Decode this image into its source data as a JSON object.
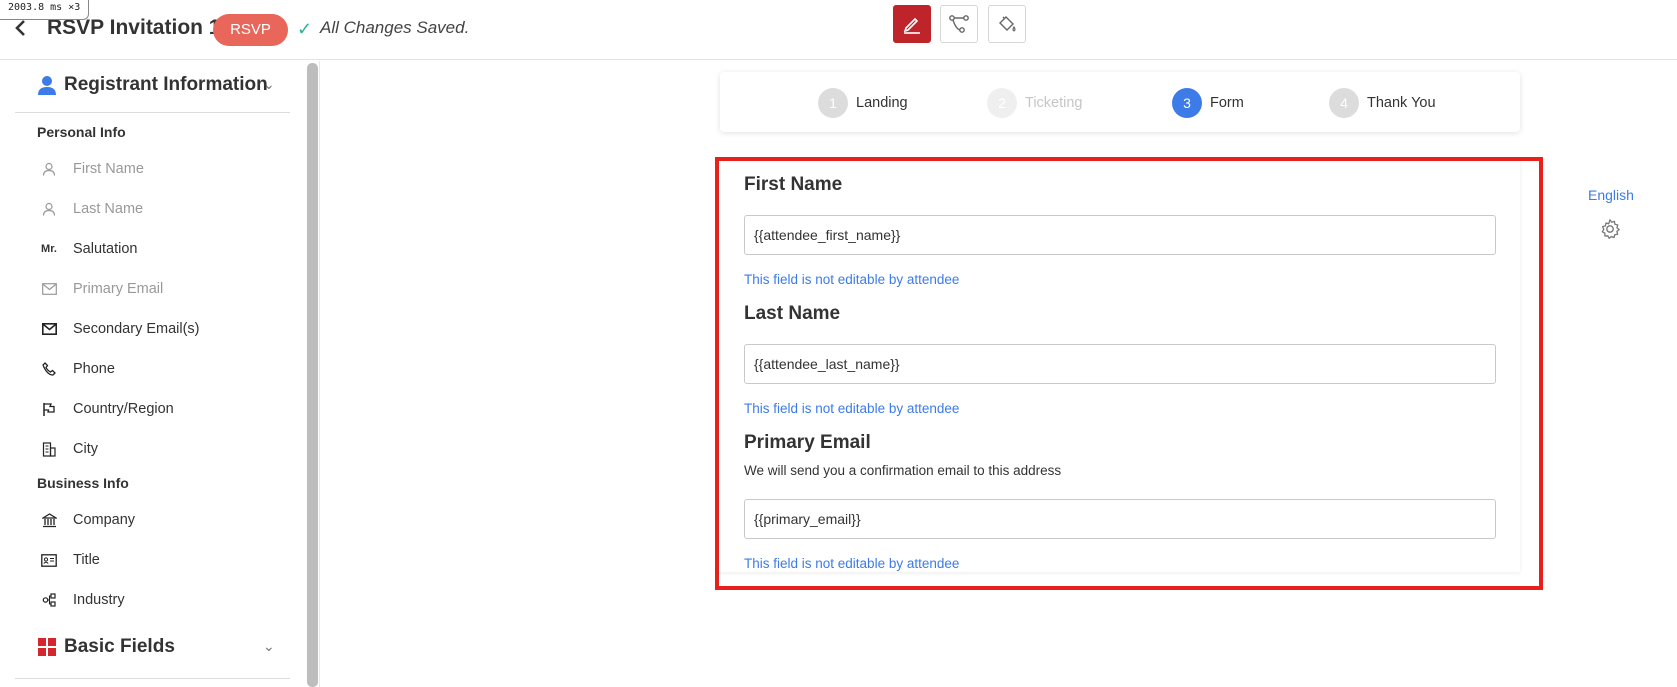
{
  "perf": {
    "ms": "2003.8",
    "unit": "ms ×3"
  },
  "header": {
    "title": "RSVP Invitation 1",
    "badge": "RSVP",
    "save_status": "All Changes Saved."
  },
  "toolbar": {
    "buttons": [
      {
        "icon": "edit-pen-icon",
        "active": true
      },
      {
        "icon": "flow-icon",
        "active": false
      },
      {
        "icon": "paint-bucket-icon",
        "active": false
      }
    ]
  },
  "sidebar": {
    "section1": {
      "title": "Registrant Information",
      "icon": "user-icon"
    },
    "personal_label": "Personal Info",
    "personal_items": [
      {
        "label": "First Name",
        "icon": "user-outline-icon",
        "muted": true
      },
      {
        "label": "Last Name",
        "icon": "user-outline-icon",
        "muted": true
      },
      {
        "label": "Salutation",
        "icon": "mr",
        "muted": false
      },
      {
        "label": "Primary Email",
        "icon": "mail-outline-icon",
        "muted": true
      },
      {
        "label": "Secondary Email(s)",
        "icon": "mail-icon",
        "muted": false
      },
      {
        "label": "Phone",
        "icon": "phone-icon",
        "muted": false
      },
      {
        "label": "Country/Region",
        "icon": "flag-icon",
        "muted": false
      },
      {
        "label": "City",
        "icon": "building-icon",
        "muted": false
      }
    ],
    "business_label": "Business Info",
    "business_items": [
      {
        "label": "Company",
        "icon": "bank-icon"
      },
      {
        "label": "Title",
        "icon": "id-card-icon"
      },
      {
        "label": "Industry",
        "icon": "industry-icon"
      }
    ],
    "section2": {
      "title": "Basic Fields",
      "icon": "grid-icon"
    },
    "icon_text_mr": "Mr."
  },
  "steps": [
    {
      "num": "1",
      "label": "Landing",
      "state": "done"
    },
    {
      "num": "2",
      "label": "Ticketing",
      "state": "faded"
    },
    {
      "num": "3",
      "label": "Form",
      "state": "active"
    },
    {
      "num": "4",
      "label": "Thank You",
      "state": "done"
    }
  ],
  "form": {
    "first_name": {
      "label": "First Name",
      "value": "{{attendee_first_name}}",
      "note": "This field is not editable by attendee"
    },
    "last_name": {
      "label": "Last Name",
      "value": "{{attendee_last_name}}",
      "note": "This field is not editable by attendee"
    },
    "primary_email": {
      "label": "Primary Email",
      "description": "We will send you a confirmation email to this address",
      "value": "{{primary_email}}",
      "note": "This field is not editable by attendee"
    }
  },
  "right_panel": {
    "language": "English"
  },
  "colors": {
    "accent": "#3c7be8",
    "brand": "#c0242b",
    "badge": "#e8675a",
    "highlight": "#e8201c",
    "saved": "#2bb59a"
  }
}
